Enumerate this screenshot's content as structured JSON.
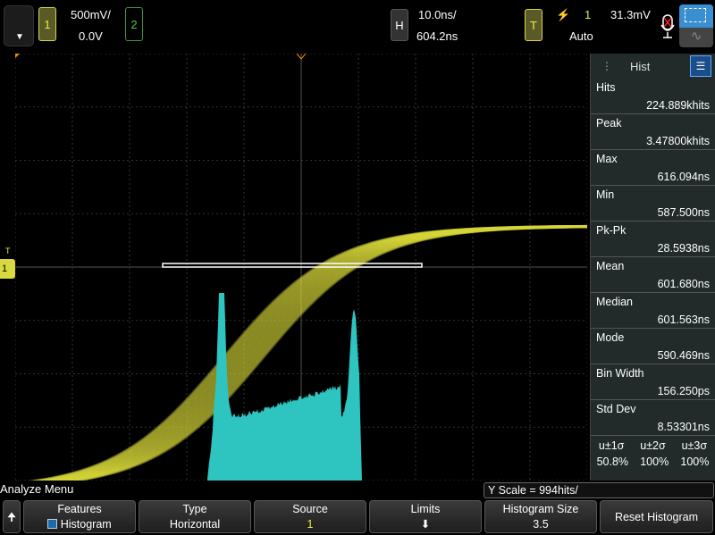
{
  "topbar": {
    "channel1": {
      "label": "1",
      "scale": "500mV/",
      "offset": "0.0V",
      "color": "#d8d840"
    },
    "channel2": {
      "label": "2",
      "color": "#3c9a3c"
    },
    "horizontal": {
      "label": "H",
      "timebase": "10.0ns/",
      "delay": "604.2ns"
    },
    "trigger": {
      "label": "T",
      "source": "1",
      "level": "31.3mV",
      "mode": "Auto",
      "slope_icon": "rising-edge-icon"
    }
  },
  "panel": {
    "tab": "Hist",
    "stats": [
      {
        "label": "Hits",
        "value": "224.889khits"
      },
      {
        "label": "Peak",
        "value": "3.47800khits"
      },
      {
        "label": "Max",
        "value": "616.094ns"
      },
      {
        "label": "Min",
        "value": "587.500ns"
      },
      {
        "label": "Pk-Pk",
        "value": "28.5938ns"
      },
      {
        "label": "Mean",
        "value": "601.680ns"
      },
      {
        "label": "Median",
        "value": "601.563ns"
      },
      {
        "label": "Mode",
        "value": "590.469ns"
      },
      {
        "label": "Bin Width",
        "value": "156.250ps"
      },
      {
        "label": "Std Dev",
        "value": "8.53301ns"
      }
    ],
    "sigma_headers": [
      "u±1σ",
      "u±2σ",
      "u±3σ"
    ],
    "sigma_values": [
      "50.8%",
      "100%",
      "100%"
    ]
  },
  "menu_title": "Analyze Menu",
  "yscale": "Y Scale = 994hits/",
  "softkeys": {
    "features": {
      "label": "Features",
      "value": "Histogram"
    },
    "type": {
      "label": "Type",
      "value": "Horizontal"
    },
    "source": {
      "label": "Source",
      "value": "1"
    },
    "limits": {
      "label": "Limits"
    },
    "histogram_size": {
      "label": "Histogram Size",
      "value": "3.5"
    },
    "reset": {
      "label": "Reset Histogram"
    }
  },
  "ground_marker": "1",
  "trigger_marker": "T",
  "colors": {
    "waveform": "#d8d838",
    "histogram": "#2ec4c0",
    "accent": "#3a8fd0"
  }
}
